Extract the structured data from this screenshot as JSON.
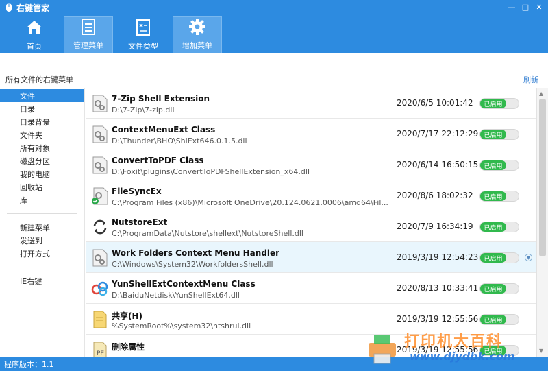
{
  "window": {
    "title": "右键管家",
    "minimize": "—",
    "maximize": "□",
    "close": "✕"
  },
  "nav": [
    {
      "label": "首页",
      "icon": "home-icon"
    },
    {
      "label": "管理菜单",
      "icon": "menu-list-icon"
    },
    {
      "label": "文件类型",
      "icon": "file-type-icon"
    },
    {
      "label": "增加菜单",
      "icon": "gear-icon"
    }
  ],
  "section": {
    "title": "所有文件的右键菜单",
    "refresh": "刷新"
  },
  "sidebar": {
    "group1": [
      "文件",
      "目录",
      "目录背景",
      "文件夹",
      "所有对象",
      "磁盘分区",
      "我的电脑",
      "回收站",
      "库"
    ],
    "group2": [
      "新建菜单",
      "发送到",
      "打开方式"
    ],
    "group3": [
      "IE右键"
    ]
  },
  "entries": [
    {
      "name": "7-Zip Shell Extension",
      "path": "D:\\7-Zip\\7-zip.dll",
      "date": "2020/6/5 10:01:42",
      "status": "已启用",
      "icon": "gears-icon"
    },
    {
      "name": "ContextMenuExt Class",
      "path": "D:\\Thunder\\BHO\\ShlExt646.0.1.5.dll",
      "date": "2020/7/17 22:12:29",
      "status": "已启用",
      "icon": "gears-icon"
    },
    {
      "name": "ConvertToPDF Class",
      "path": "D:\\Foxit\\plugins\\ConvertToPDFShellExtension_x64.dll",
      "date": "2020/6/14 16:50:15",
      "status": "已启用",
      "icon": "gears-icon"
    },
    {
      "name": "FileSyncEx",
      "path": "C:\\Program Files (x86)\\Microsoft OneDrive\\20.124.0621.0006\\amd64\\Fil...",
      "date": "2020/8/6 18:02:32",
      "status": "已启用",
      "icon": "gears-check-icon"
    },
    {
      "name": "NutstoreExt",
      "path": "C:\\ProgramData\\Nutstore\\shellext\\NutstoreShell.dll",
      "date": "2020/7/9 16:34:19",
      "status": "已启用",
      "icon": "sync-arrows-icon"
    },
    {
      "name": "Work Folders Context Menu Handler",
      "path": "C:\\Windows\\System32\\WorkfoldersShell.dll",
      "date": "2019/3/19 12:54:23",
      "status": "已启用",
      "icon": "gears-icon"
    },
    {
      "name": "YunShellExtContextMenu Class",
      "path": "D:\\BaiduNetdisk\\YunShellExt64.dll",
      "date": "2020/8/13 10:33:41",
      "status": "已启用",
      "icon": "cloud-icon"
    },
    {
      "name": "共享(H)",
      "path": "%SystemRoot%\\system32\\ntshrui.dll",
      "date": "2019/3/19 12:55:56",
      "status": "已启用",
      "icon": "folder-share-icon"
    },
    {
      "name": "删除属性",
      "path": "",
      "date": "2019/3/19 12:55:56",
      "status": "已启用",
      "icon": "document-icon"
    }
  ],
  "statusbar": {
    "version_label": "程序版本：1.1"
  },
  "watermark": {
    "text": "打印机大百科",
    "url": "www.djydbk.com"
  },
  "colors": {
    "accent": "#2d8be0",
    "toggle_on": "#31b94d"
  }
}
